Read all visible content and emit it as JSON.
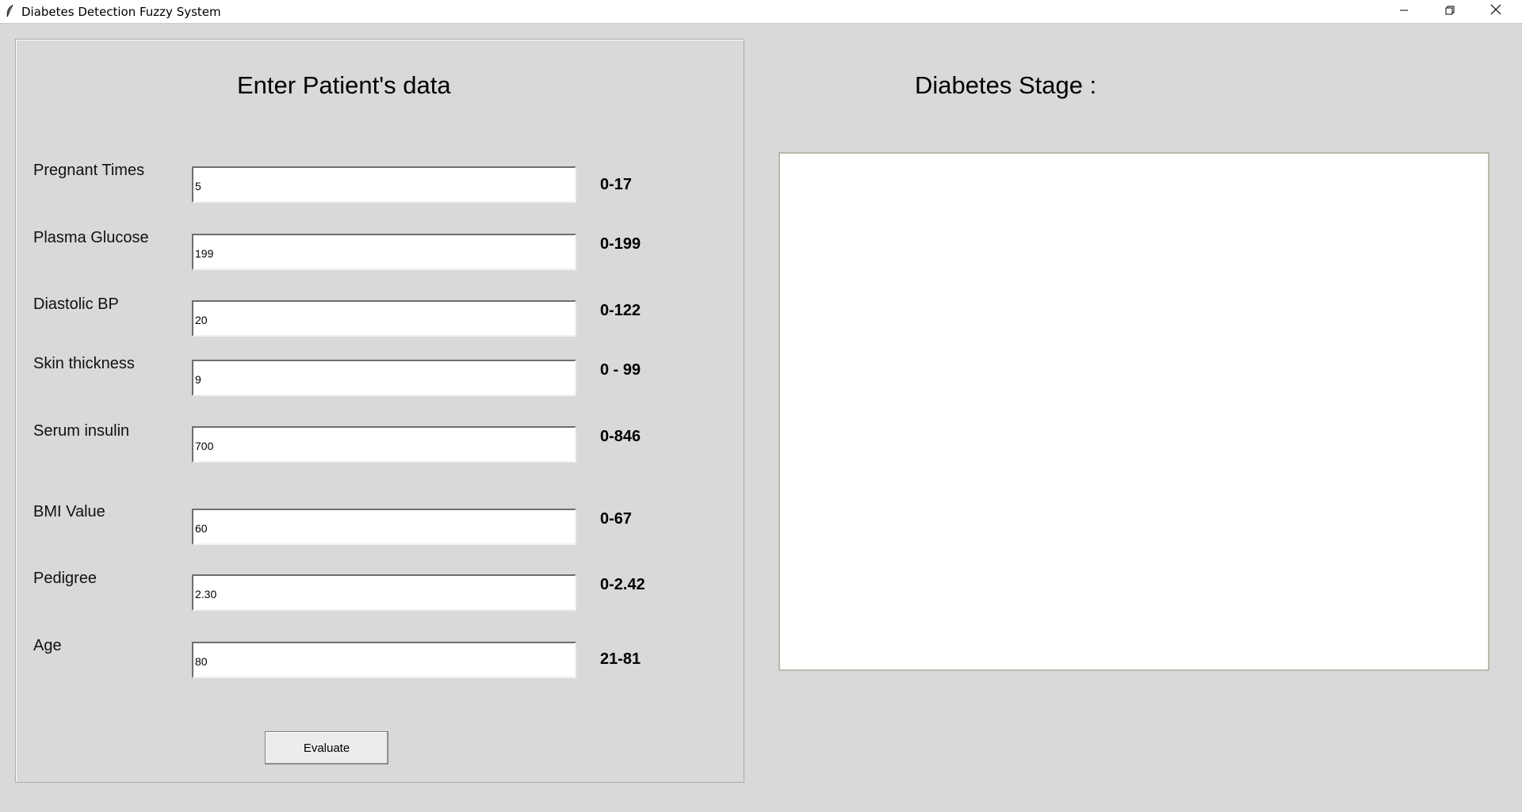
{
  "window": {
    "title": "Diabetes Detection Fuzzy System",
    "icon": "feather-icon",
    "controls": [
      "minimize-icon",
      "restore-icon",
      "close-icon"
    ]
  },
  "left_panel": {
    "heading": "Enter Patient's data",
    "fields": [
      {
        "label": "Pregnant Times",
        "value": "5",
        "range": "0-17"
      },
      {
        "label": "Plasma Glucose",
        "value": "199",
        "range": "0-199"
      },
      {
        "label": "Diastolic BP",
        "value": "20",
        "range": "0-122"
      },
      {
        "label": "Skin thickness",
        "value": "9",
        "range": "0 - 99"
      },
      {
        "label": "Serum insulin",
        "value": "700",
        "range": "0-846"
      },
      {
        "label": "BMI Value",
        "value": "60",
        "range": "0-67"
      },
      {
        "label": "Pedigree",
        "value": "2.30",
        "range": "0-2.42"
      },
      {
        "label": "Age",
        "value": "80",
        "range": "21-81"
      }
    ],
    "evaluate_label": "Evaluate"
  },
  "right_panel": {
    "heading": "Diabetes Stage :",
    "result": ""
  },
  "colors": {
    "window_bg": "#d9d9d9",
    "input_bg": "#ffffff",
    "titlebar_bg": "#ffffff"
  }
}
